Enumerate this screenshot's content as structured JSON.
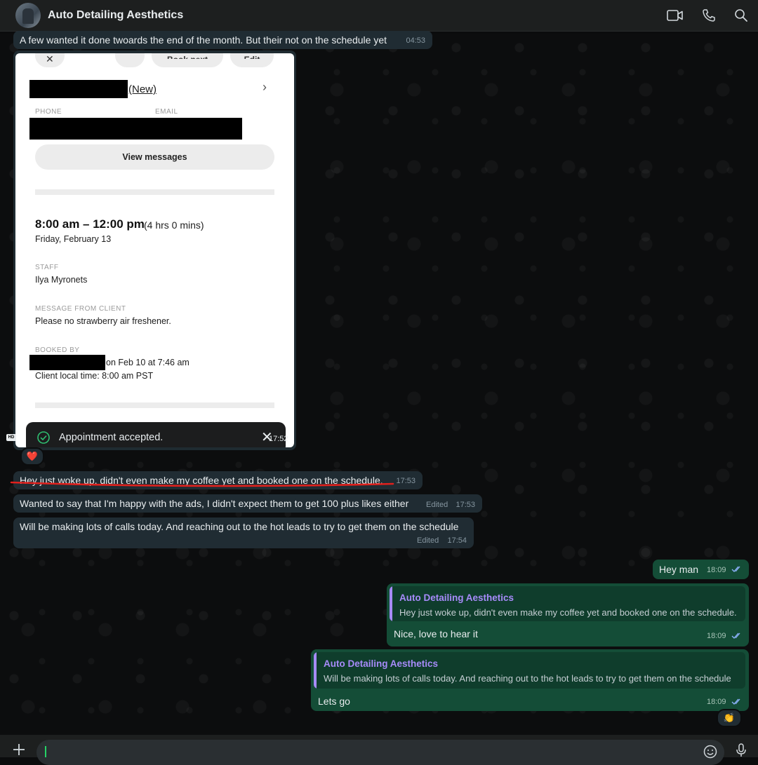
{
  "header": {
    "title": "Auto Detailing Aesthetics",
    "icons": [
      "video-call-icon",
      "voice-call-icon",
      "search-icon"
    ]
  },
  "messages": {
    "m1": {
      "text": "A few wanted it done twoards the end of the month. But their not on the schedule yet",
      "time": "04:53"
    },
    "image": {
      "time": "17:52",
      "hd": "HD",
      "card": {
        "top_pills": [
          "Book next",
          "Edit"
        ],
        "new_label": "(New)",
        "phone_label": "PHONE",
        "email_label": "EMAIL",
        "view_messages": "View messages",
        "time_range": "8:00 am – 12:00 pm",
        "duration": "(4 hrs 0 mins)",
        "date": "Friday, February 13",
        "staff_label": "STAFF",
        "staff": "Ilya Myronets",
        "message_label": "MESSAGE FROM CLIENT",
        "message": "Please no strawberry air freshener.",
        "booked_label": "BOOKED BY",
        "booked": "on Feb 10 at 7:46 am",
        "local_time": "Client local time: 8:00 am PST",
        "toast": "Appointment accepted."
      },
      "reaction": "❤️"
    },
    "m2": {
      "text": "Hey just woke up, didn't even make my coffee yet and booked one on the schedule.",
      "time": "17:53"
    },
    "m3": {
      "text": "Wanted to say that I'm happy with the ads, I didn't expect them to get 100 plus likes either",
      "edited": "Edited",
      "time": "17:53"
    },
    "m4": {
      "text": "Will be making lots of calls today. And reaching out to the hot leads to try to get them on the schedule",
      "edited": "Edited",
      "time": "17:54"
    },
    "o1": {
      "text": "Hey man",
      "time": "18:09"
    },
    "o2": {
      "quote_author": "Auto Detailing Aesthetics",
      "quote_text": "Hey just woke up, didn't even make my coffee yet and booked one on the schedule.",
      "text": "Nice, love to hear it",
      "time": "18:09"
    },
    "o3": {
      "quote_author": "Auto Detailing Aesthetics",
      "quote_text": "Will be making lots of calls today. And reaching out to the hot leads to try to get them on the schedule",
      "text": "Lets go",
      "time": "18:09",
      "reaction": "👏"
    }
  },
  "colors": {
    "incoming_bubble": "#202c33",
    "outgoing_bubble": "#144d37",
    "quote_accent": "#a78bfa",
    "underline": "#e0201c",
    "read_ticks": "#8fb4ff"
  }
}
